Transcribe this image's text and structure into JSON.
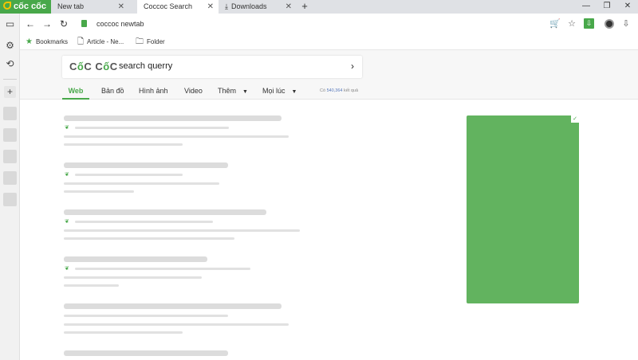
{
  "tabs": {
    "brand": "cốc cốc",
    "items": [
      {
        "label": "New tab",
        "close": "✕"
      },
      {
        "label": "Coccoc Search",
        "close": "✕"
      },
      {
        "label": "Downloads",
        "close": "✕"
      }
    ],
    "new_tab": "+"
  },
  "window_controls": {
    "minimize": "—",
    "restore": "❐",
    "close": "✕"
  },
  "toolbar": {
    "back": "←",
    "forward": "→",
    "reload": "↻",
    "url": "coccoc newtab",
    "cart": "🛒",
    "star": "☆",
    "download_green": "⇩",
    "download": "⇩"
  },
  "sidebar": {
    "panel": "▭",
    "settings": "⚙",
    "history": "⟲",
    "add": "+"
  },
  "bookmarks": [
    {
      "icon": "★",
      "label": "Bookmarks"
    },
    {
      "icon": "🗋",
      "label": "Article - Ne..."
    },
    {
      "icon": "🗀",
      "label": "Folder"
    }
  ],
  "search": {
    "brand_prefix": "C",
    "brand_o1": "ố",
    "brand_mid": "C C",
    "brand_o2": "ố",
    "brand_suffix": "C",
    "query": "search querry",
    "go": "›"
  },
  "nav_tabs": [
    {
      "label": "Web"
    },
    {
      "label": "Bản đồ"
    },
    {
      "label": "Hình ảnh"
    },
    {
      "label": "Video"
    },
    {
      "label": "Thêm",
      "caret": "▼"
    },
    {
      "label": "Mọi lúc",
      "caret": "▼"
    }
  ],
  "result_count": {
    "prefix": "Có",
    "count": "540,364",
    "suffix": "kết quả"
  },
  "ad": {
    "badge": "✓"
  }
}
